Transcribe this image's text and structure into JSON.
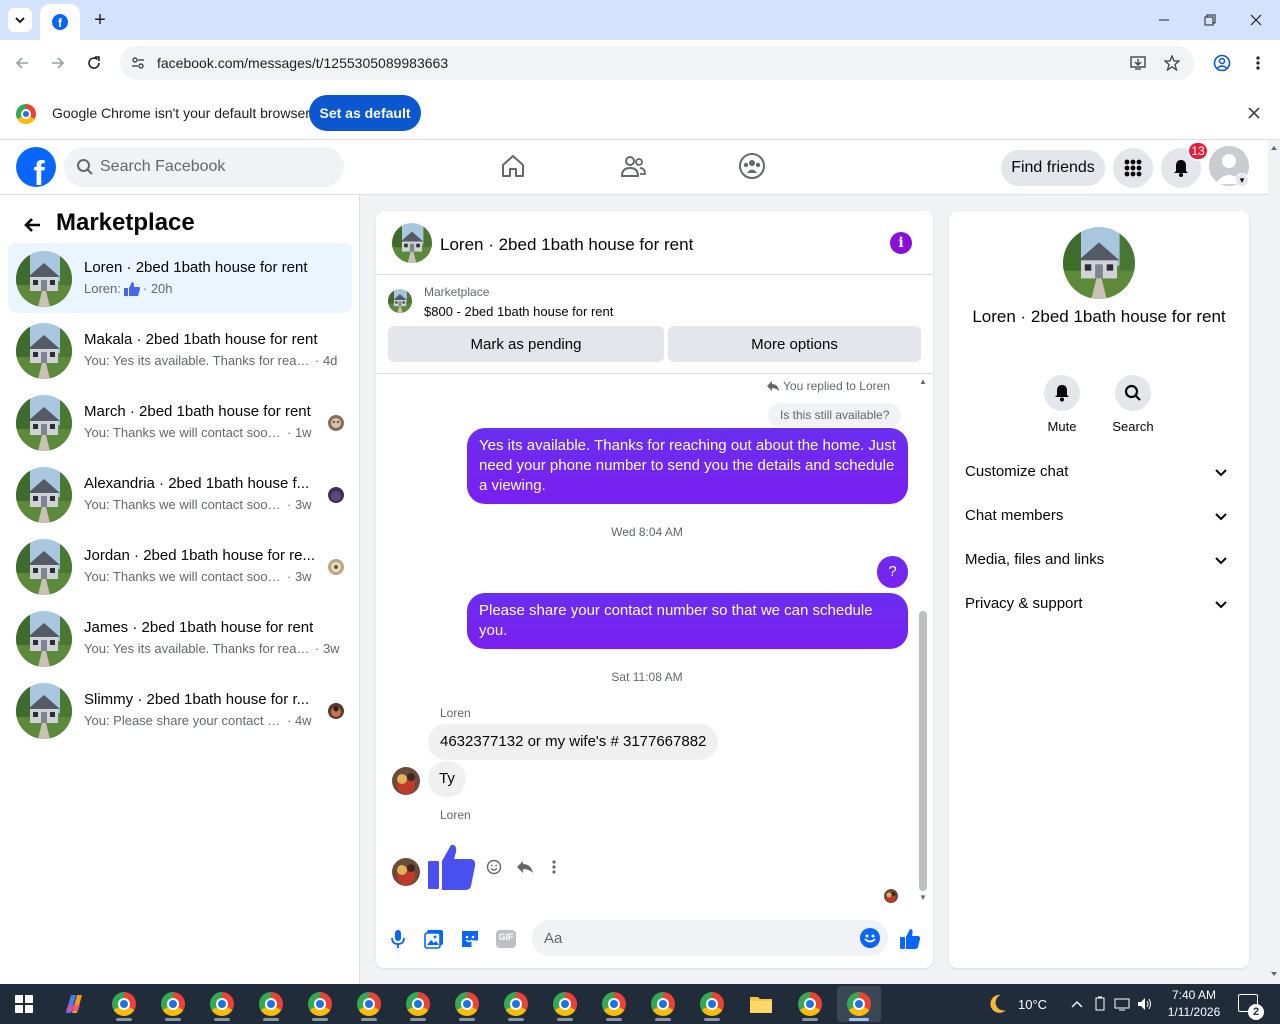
{
  "browser": {
    "url": "facebook.com/messages/t/1255305089983663",
    "infobar_message": "Google Chrome isn't your default browser",
    "set_default_label": "Set as default"
  },
  "facebook": {
    "search_placeholder": "Search Facebook",
    "find_friends_label": "Find friends",
    "notification_count": "13"
  },
  "sidebar": {
    "title": "Marketplace",
    "conversations": [
      {
        "name": "Loren · 2bed 1bath house for rent",
        "preview": "Loren: ",
        "time": "· 20h",
        "active": true
      },
      {
        "name": "Makala · 2bed 1bath house for rent",
        "preview": "You: Yes its available. Thanks for reach...",
        "time": "· 4d"
      },
      {
        "name": "March · 2bed 1bath house for rent",
        "preview": "You: Thanks we will contact soon ...",
        "time": "· 1w"
      },
      {
        "name": "Alexandria · 2bed 1bath house f...",
        "preview": "You: Thanks we will contact soon ...",
        "time": "· 3w"
      },
      {
        "name": "Jordan · 2bed 1bath house for re...",
        "preview": "You: Thanks we will contact soon ...",
        "time": "· 3w"
      },
      {
        "name": "James · 2bed 1bath house for rent",
        "preview": "You: Yes its available. Thanks for reach...",
        "time": "· 3w"
      },
      {
        "name": "Slimmy · 2bed 1bath house for r...",
        "preview": "You: Please share your contact nu...",
        "time": "· 4w"
      }
    ]
  },
  "chat": {
    "title": "Loren · 2bed 1bath house for rent",
    "marketplace_label": "Marketplace",
    "listing": "$800 - 2bed 1bath house for rent",
    "mark_pending_label": "Mark as pending",
    "more_options_label": "More options",
    "reply_note": "You replied to Loren",
    "quoted_message": "Is this still available?",
    "messages": {
      "out1": "Yes its available. Thanks for reaching out about the home. Just need your phone number to send you the details and schedule a viewing.",
      "ts1": "Wed 8:04 AM",
      "out2": "?",
      "out3": "Please share your contact number so that we can schedule you.",
      "ts2": "Sat 11:08 AM",
      "sender1": "Loren",
      "in1": "4632377132 or my wife's # 3177667882",
      "in2": "Ty",
      "sender2": "Loren"
    },
    "composer_placeholder": "Aa",
    "gif_label": "GIF"
  },
  "details": {
    "name": "Loren · 2bed 1bath house for rent",
    "mute_label": "Mute",
    "search_label": "Search",
    "sections": [
      "Customize chat",
      "Chat members",
      "Media, files and links",
      "Privacy & support"
    ]
  },
  "taskbar": {
    "weather": "10°C",
    "time": "7:40 AM",
    "date": "1/11/2026",
    "notification_count": "2"
  },
  "colors": {
    "facebook_blue": "#0866ff",
    "bubble_purple": "#7023f0",
    "active_row": "#ebf5ff"
  }
}
